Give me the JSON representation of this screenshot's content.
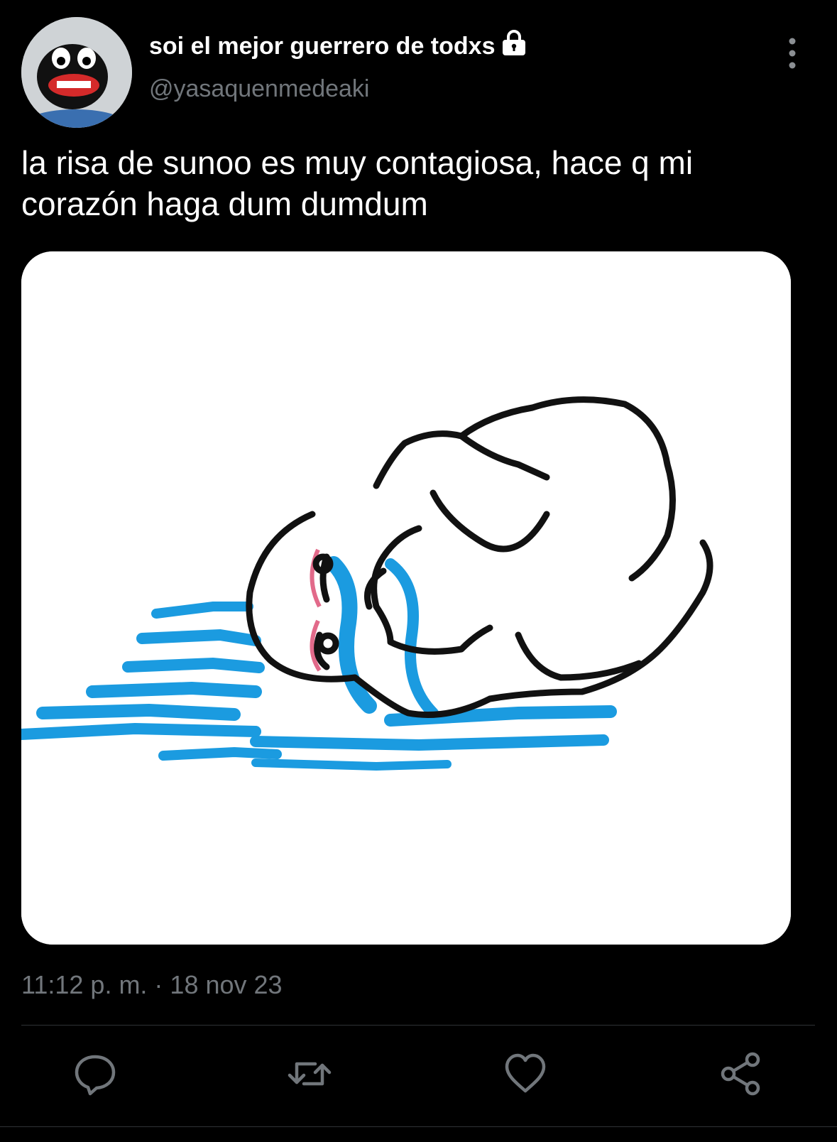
{
  "tweet": {
    "display_name": "soi el mejor guerrero de todxs",
    "handle": "@yasaquenmedeaki",
    "protected_icon": "lock-icon",
    "text": "la risa de sunoo es muy contagiosa, hace q mi corazón haga dum dumdum",
    "timestamp": "11:12 p. m. · 18 nov 23",
    "media_icon": "crying-wojak-drawing"
  },
  "actions": [
    {
      "name": "reply",
      "icon": "reply-icon"
    },
    {
      "name": "retweet",
      "icon": "retweet-icon"
    },
    {
      "name": "like",
      "icon": "heart-icon"
    },
    {
      "name": "share",
      "icon": "share-icon"
    }
  ],
  "colors": {
    "background": "#000000",
    "text": "#ffffff",
    "secondary": "#71767b",
    "tear_blue": "#1b9be0"
  }
}
